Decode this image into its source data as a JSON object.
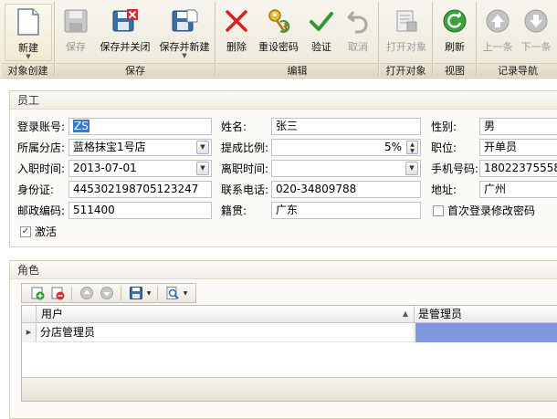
{
  "ribbon": {
    "groups": [
      {
        "caption": "对象创建",
        "buttons": [
          {
            "label": "新建",
            "icon": "new-document-icon"
          }
        ]
      },
      {
        "caption": "保存",
        "buttons": [
          {
            "label": "保存",
            "icon": "save-icon",
            "disabled": true
          },
          {
            "label": "保存并关闭",
            "icon": "save-close-icon"
          },
          {
            "label": "保存并新建",
            "icon": "save-new-icon"
          }
        ]
      },
      {
        "caption": "编辑",
        "buttons": [
          {
            "label": "删除",
            "icon": "delete-icon"
          },
          {
            "label": "重设密码",
            "icon": "reset-password-key-icon"
          },
          {
            "label": "验证",
            "icon": "validate-check-icon"
          },
          {
            "label": "取消",
            "icon": "undo-icon",
            "disabled": true
          }
        ]
      },
      {
        "caption": "打开对象",
        "buttons": [
          {
            "label": "打开对象",
            "icon": "open-object-icon",
            "disabled": true
          }
        ]
      },
      {
        "caption": "视图",
        "buttons": [
          {
            "label": "刷新",
            "icon": "refresh-icon"
          }
        ]
      },
      {
        "caption": "记录导航",
        "buttons": [
          {
            "label": "上一条",
            "icon": "previous-record-icon",
            "disabled": true
          },
          {
            "label": "下一条",
            "icon": "next-record-icon",
            "disabled": true
          }
        ]
      }
    ]
  },
  "employee": {
    "title": "员工",
    "login_label": "登录账号:",
    "login_value": "ZS",
    "name_label": "姓名:",
    "name_value": "张三",
    "gender_label": "性别:",
    "gender_value": "男",
    "branch_label": "所属分店:",
    "branch_value": "蓝格抹宝1号店",
    "commission_label": "提成比例:",
    "commission_value": "5%",
    "position_label": "职位:",
    "position_value": "开单员",
    "hire_label": "入职时间:",
    "hire_value": "2013-07-01",
    "leave_label": "离职时间:",
    "leave_value": "",
    "mobile_label": "手机号码:",
    "mobile_value": "18022375558",
    "id_label": "身份证:",
    "id_value": "445302198705123247",
    "phone_label": "联系电话:",
    "phone_value": "020-34809788",
    "address_label": "地址:",
    "address_value": "广州",
    "postcode_label": "邮政编码:",
    "postcode_value": "511400",
    "origin_label": "籍贯:",
    "origin_value": "广东",
    "first_login_label": "首次登录修改密码",
    "first_login_checked": false,
    "active_label": "激活",
    "active_checked": true
  },
  "roles": {
    "title": "角色",
    "columns": [
      "用户",
      "是管理员"
    ],
    "rows": [
      {
        "user": "分店管理员",
        "is_admin": ""
      }
    ]
  }
}
